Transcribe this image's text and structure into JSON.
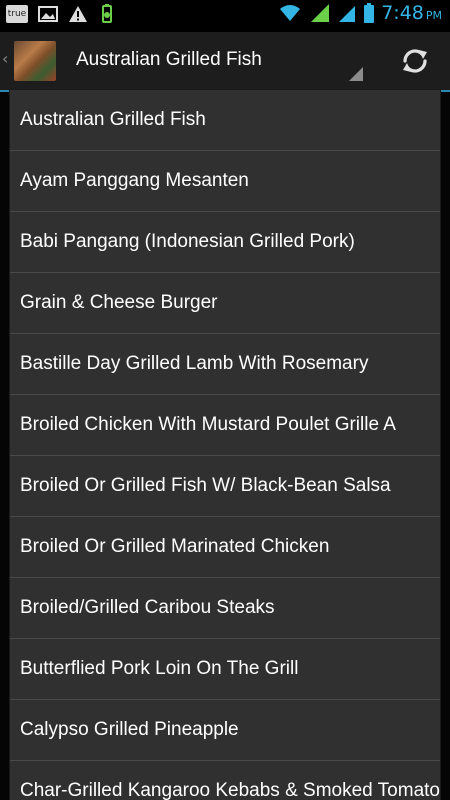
{
  "status_bar": {
    "carrier_badge": "true",
    "time": "7:48",
    "ampm": "PM"
  },
  "action_bar": {
    "title": "Australian Grilled Fish",
    "refresh_icon": "refresh-icon",
    "thumbnail_icon": "recipe-thumbnail"
  },
  "dropdown": {
    "items": [
      "Australian Grilled Fish",
      "Ayam Panggang Mesanten",
      "Babi Pangang (Indonesian Grilled Pork)",
      "Grain & Cheese Burger",
      "Bastille Day Grilled Lamb With Rosemary",
      "Broiled Chicken With Mustard Poulet Grille A",
      "Broiled Or Grilled Fish W/ Black-Bean Salsa",
      "Broiled Or Grilled Marinated Chicken",
      "Broiled/Grilled Caribou Steaks",
      "Butterflied Pork Loin On The Grill",
      "Calypso Grilled Pineapple",
      "Char-Grilled Kangaroo Kebabs & Smoked Tomato"
    ]
  },
  "colors": {
    "accent": "#33b5e5",
    "list_bg": "#303030",
    "divider": "#4a4a4a"
  }
}
